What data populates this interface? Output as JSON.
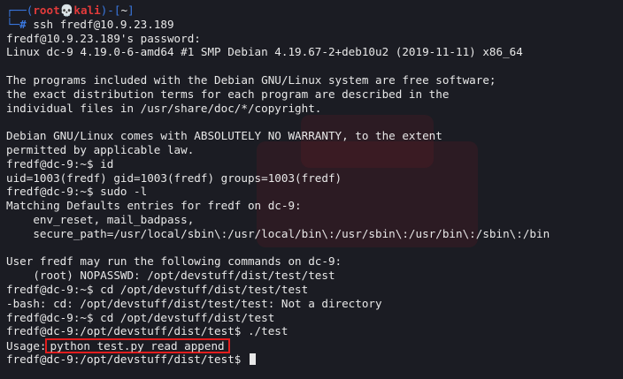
{
  "prompt": {
    "corner_top": "┌──(",
    "user": "root",
    "skull": "💀",
    "host": "kali",
    "mid": ")-[",
    "path": "~",
    "close": "]",
    "corner_bottom": "└─",
    "hash": "#"
  },
  "ssh_command": "ssh fredf@10.9.23.189",
  "lines": [
    "fredf@10.9.23.189's password:",
    "Linux dc-9 4.19.0-6-amd64 #1 SMP Debian 4.19.67-2+deb10u2 (2019-11-11) x86_64",
    "",
    "The programs included with the Debian GNU/Linux system are free software;",
    "the exact distribution terms for each program are described in the",
    "individual files in /usr/share/doc/*/copyright.",
    "",
    "Debian GNU/Linux comes with ABSOLUTELY NO WARRANTY, to the extent",
    "permitted by applicable law.",
    "fredf@dc-9:~$ id",
    "uid=1003(fredf) gid=1003(fredf) groups=1003(fredf)",
    "fredf@dc-9:~$ sudo -l",
    "Matching Defaults entries for fredf on dc-9:",
    "    env_reset, mail_badpass,",
    "    secure_path=/usr/local/sbin\\:/usr/local/bin\\:/usr/sbin\\:/usr/bin\\:/sbin\\:/bin",
    "",
    "User fredf may run the following commands on dc-9:",
    "    (root) NOPASSWD: /opt/devstuff/dist/test/test",
    "fredf@dc-9:~$ cd /opt/devstuff/dist/test/test",
    "-bash: cd: /opt/devstuff/dist/test/test: Not a directory",
    "fredf@dc-9:~$ cd /opt/devstuff/dist/test",
    "fredf@dc-9:/opt/devstuff/dist/test$ ./test"
  ],
  "usage": {
    "label": "Usage:",
    "text": "python test.py read append"
  },
  "final_prompt": "fredf@dc-9:/opt/devstuff/dist/test$ ",
  "colors": {
    "background": "#1b1c23",
    "text": "#e8e8e8",
    "prompt_blue": "#3a78e0",
    "prompt_red": "#e23b3b",
    "highlight_border": "#e21d1d"
  }
}
